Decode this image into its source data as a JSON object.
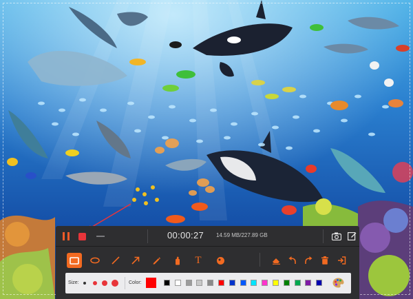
{
  "recording": {
    "elapsed_time": "00:00:27",
    "file_size": "14.59 MB/227.89 GB"
  },
  "tools": [
    {
      "name": "rectangle",
      "icon": "rectangle-icon",
      "active": true
    },
    {
      "name": "ellipse",
      "icon": "ellipse-icon"
    },
    {
      "name": "line",
      "icon": "line-icon"
    },
    {
      "name": "arrow",
      "icon": "arrow-icon"
    },
    {
      "name": "pen",
      "icon": "pen-icon"
    },
    {
      "name": "highlighter",
      "icon": "highlighter-icon"
    },
    {
      "name": "text",
      "icon": "text-icon",
      "glyph": "T"
    },
    {
      "name": "callout",
      "icon": "callout-icon"
    },
    {
      "name": "eraser",
      "icon": "eraser-icon"
    },
    {
      "name": "undo",
      "icon": "undo-icon"
    },
    {
      "name": "redo",
      "icon": "redo-icon"
    },
    {
      "name": "clear",
      "icon": "trash-icon"
    },
    {
      "name": "exit-drawing",
      "icon": "exit-icon"
    }
  ],
  "options": {
    "size_label": "Size:",
    "color_label": "Color:",
    "current_color": "#ff0000",
    "sizes": [
      "small",
      "medium",
      "large",
      "x-large"
    ],
    "palette": [
      "#000000",
      "#ffffff",
      "#9c9c9c",
      "#c8c8c8",
      "#8a8a8a",
      "#ff0000",
      "#0033cc",
      "#0058ff",
      "#00e5ff",
      "#ff33cc",
      "#ffff00",
      "#008000",
      "#00a84f",
      "#7f1aa6",
      "#0000b0"
    ]
  },
  "colors": {
    "accent": "#f26a21",
    "stop": "#e8353a",
    "toolbar_bg": "#2e2e30",
    "options_bg": "#ececee"
  }
}
